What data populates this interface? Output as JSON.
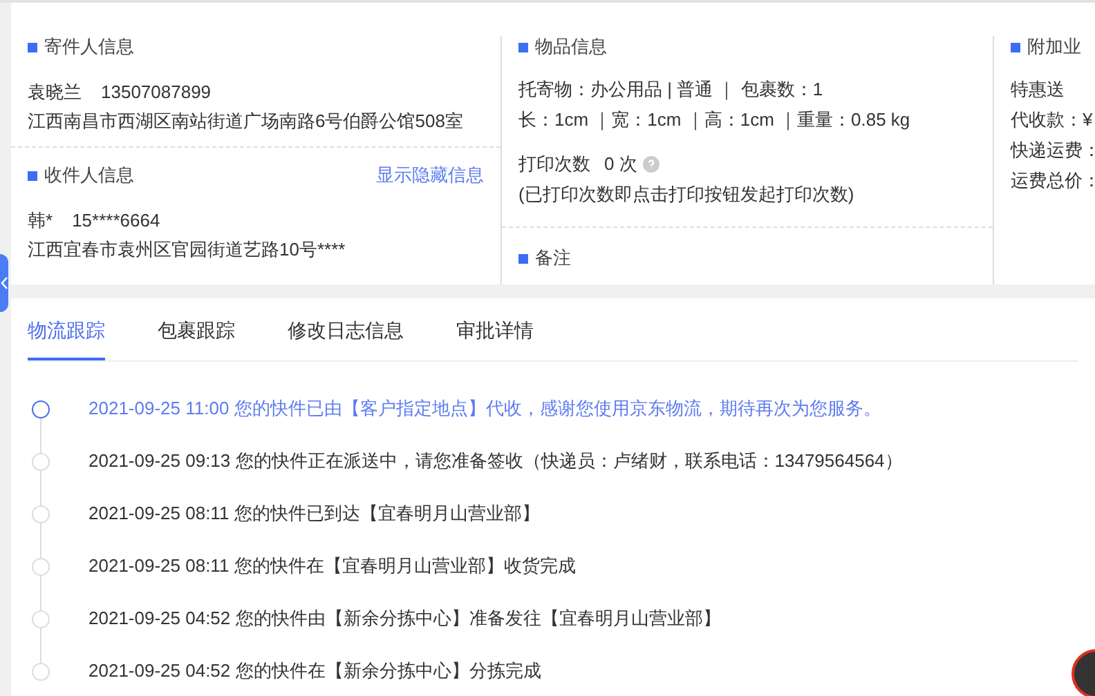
{
  "sender": {
    "title": "寄件人信息",
    "name": "袁晓兰",
    "phone": "13507087899",
    "address": "江西南昌市西湖区南站街道广场南路6号伯爵公馆508室"
  },
  "receiver": {
    "title": "收件人信息",
    "action": "显示隐藏信息",
    "name": "韩*",
    "phone": "15****6664",
    "address": "江西宜春市袁州区官园街道艺路10号****"
  },
  "goods": {
    "title": "物品信息",
    "lines": [
      "托寄物：办公用品 | 普通 ｜ 包裹数：1",
      "长：1cm ｜宽：1cm ｜高：1cm ｜重量：0.85 kg"
    ],
    "print_label": "打印次数",
    "print_count": "0 次",
    "print_note": "(已打印次数即点击打印按钮发起打印次数)"
  },
  "remark": {
    "title": "备注"
  },
  "extras": {
    "title": "附加业",
    "lines": [
      "特惠送",
      "代收款：¥",
      "快递运费：",
      "运费总价："
    ]
  },
  "tabs": [
    {
      "label": "物流跟踪",
      "selected": true
    },
    {
      "label": "包裹跟踪",
      "selected": false
    },
    {
      "label": "修改日志信息",
      "selected": false
    },
    {
      "label": "审批详情",
      "selected": false
    }
  ],
  "timeline": [
    {
      "text": "2021-09-25 11:00 您的快件已由【客户指定地点】代收，感谢您使用京东物流，期待再次为您服务。",
      "current": true
    },
    {
      "text": "2021-09-25 09:13 您的快件正在派送中，请您准备签收（快递员：卢绪财，联系电话：13479564564）",
      "current": false
    },
    {
      "text": "2021-09-25 08:11 您的快件已到达【宜春明月山营业部】",
      "current": false
    },
    {
      "text": "2021-09-25 08:11 您的快件在【宜春明月山营业部】收货完成",
      "current": false
    },
    {
      "text": "2021-09-25 04:52 您的快件由【新余分拣中心】准备发往【宜春明月山营业部】",
      "current": false
    },
    {
      "text": "2021-09-25 04:52 您的快件在【新余分拣中心】分拣完成",
      "current": false
    }
  ]
}
